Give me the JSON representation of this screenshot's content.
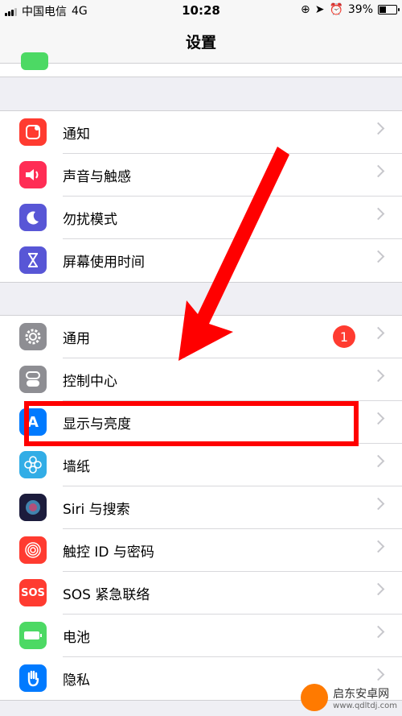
{
  "status_bar": {
    "carrier": "中国电信",
    "network": "4G",
    "time": "10:28",
    "battery_percent": "39%",
    "battery_level": 0.39
  },
  "nav": {
    "title": "设置"
  },
  "group1": [
    {
      "label": "通知",
      "icon": "notifications-icon",
      "color": "#ff3b30"
    },
    {
      "label": "声音与触感",
      "icon": "speaker-icon",
      "color": "#ff2d55"
    },
    {
      "label": "勿扰模式",
      "icon": "moon-icon",
      "color": "#5856d6"
    },
    {
      "label": "屏幕使用时间",
      "icon": "hourglass-icon",
      "color": "#5856d6"
    }
  ],
  "group2": [
    {
      "label": "通用",
      "icon": "gear-icon",
      "color": "#8e8e93",
      "badge": "1"
    },
    {
      "label": "控制中心",
      "icon": "toggles-icon",
      "color": "#8e8e93"
    },
    {
      "label": "显示与亮度",
      "icon": "display-icon",
      "color": "#007aff",
      "icon_text": "A"
    },
    {
      "label": "墙纸",
      "icon": "wallpaper-icon",
      "color": "#32ade6"
    },
    {
      "label": "Siri 与搜索",
      "icon": "siri-icon",
      "color": "#1c1c3c"
    },
    {
      "label": "触控 ID 与密码",
      "icon": "fingerprint-icon",
      "color": "#ff3b30"
    },
    {
      "label": "SOS 紧急联络",
      "icon": "sos-icon",
      "color": "#ff3b30",
      "icon_text": "SOS"
    },
    {
      "label": "电池",
      "icon": "battery-icon",
      "color": "#4cd964"
    },
    {
      "label": "隐私",
      "icon": "hand-icon",
      "color": "#007aff"
    }
  ],
  "watermark": {
    "title": "启东安卓网",
    "url": "www.qdltdj.com"
  }
}
